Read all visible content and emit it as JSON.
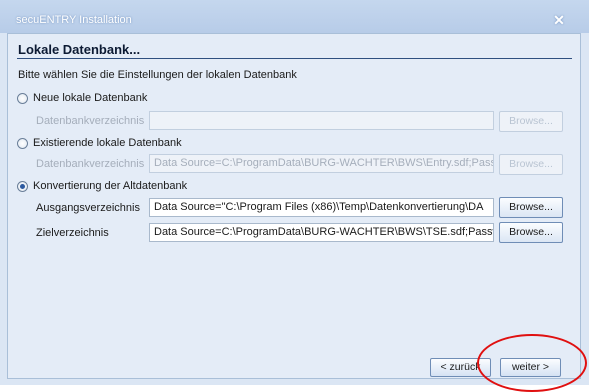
{
  "window": {
    "title": "secuENTRY Installation",
    "close_glyph": "✕"
  },
  "page": {
    "heading": "Lokale Datenbank...",
    "description": "Bitte wählen Sie die Einstellungen der lokalen Datenbank"
  },
  "options": [
    {
      "label": "Neue lokale Datenbank",
      "checked": false,
      "field_label": "Datenbankverzeichnis",
      "field_value": "",
      "button_label": "Browse..."
    },
    {
      "label": "Existierende lokale Datenbank",
      "checked": false,
      "field_label": "Datenbankverzeichnis",
      "field_value": "Data Source=C:\\ProgramData\\BURG-WACHTER\\BWS\\Entry.sdf;Pass",
      "button_label": "Browse..."
    },
    {
      "label": "Konvertierung der Altdatenbank",
      "checked": true,
      "source_label": "Ausgangsverzeichnis",
      "source_value": "Data Source=\"C:\\Program Files (x86)\\Temp\\Datenkonvertierung\\DA",
      "source_button": "Browse...",
      "target_label": "Zielverzeichnis",
      "target_value": "Data Source=C:\\ProgramData\\BURG-WACHTER\\BWS\\TSE.sdf;Passw",
      "target_button": "Browse..."
    }
  ],
  "footer": {
    "back_label": "< zurück",
    "next_label": "weiter >"
  },
  "colors": {
    "annotation": "#e01010",
    "accent": "#2d5aa0"
  }
}
